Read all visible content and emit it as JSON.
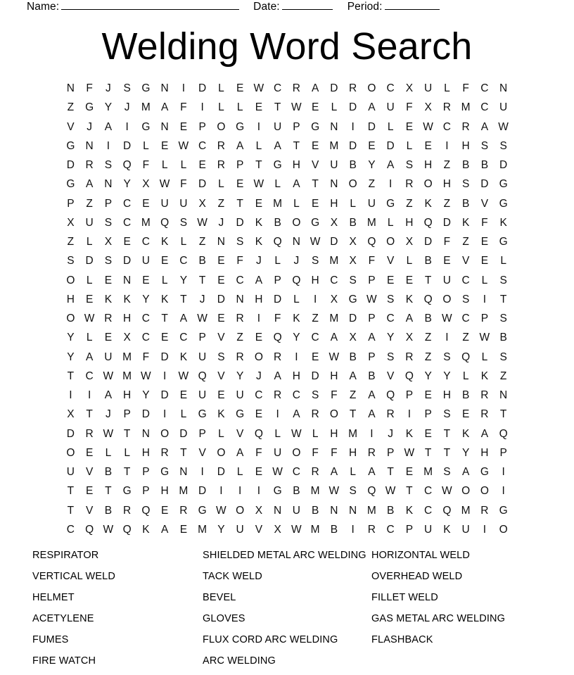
{
  "header": {
    "name_label": "Name:",
    "date_label": "Date:",
    "period_label": "Period:"
  },
  "title": "Welding Word Search",
  "grid": {
    "rows": 24,
    "cols": 23,
    "letters": [
      [
        "N",
        "F",
        "J",
        "S",
        "G",
        "N",
        "I",
        "D",
        "L",
        "E",
        "W",
        "C",
        "R",
        "A",
        "D",
        "R",
        "O",
        "C",
        "X",
        "U",
        "L",
        "F",
        "C",
        "N"
      ],
      [
        "Z",
        "G",
        "Y",
        "J",
        "M",
        "A",
        "F",
        "I",
        "L",
        "L",
        "E",
        "T",
        "W",
        "E",
        "L",
        "D",
        "A",
        "U",
        "F",
        "X",
        "R",
        "M",
        "C",
        "U"
      ],
      [
        "V",
        "J",
        "A",
        "I",
        "G",
        "N",
        "E",
        "P",
        "O",
        "G",
        "I",
        "U",
        "P",
        "G",
        "N",
        "I",
        "D",
        "L",
        "E",
        "W",
        "C",
        "R",
        "A",
        "W"
      ],
      [
        "G",
        "N",
        "I",
        "D",
        "L",
        "E",
        "W",
        "C",
        "R",
        "A",
        "L",
        "A",
        "T",
        "E",
        "M",
        "D",
        "E",
        "D",
        "L",
        "E",
        "I",
        "H",
        "S",
        "S"
      ],
      [
        "D",
        "R",
        "S",
        "Q",
        "F",
        "L",
        "L",
        "E",
        "R",
        "P",
        "T",
        "G",
        "H",
        "V",
        "U",
        "B",
        "Y",
        "A",
        "S",
        "H",
        "Z",
        "B",
        "B",
        "D"
      ],
      [
        "G",
        "A",
        "N",
        "Y",
        "X",
        "W",
        "F",
        "D",
        "L",
        "E",
        "W",
        "L",
        "A",
        "T",
        "N",
        "O",
        "Z",
        "I",
        "R",
        "O",
        "H",
        "S",
        "D",
        "G"
      ],
      [
        "P",
        "Z",
        "P",
        "C",
        "E",
        "U",
        "U",
        "X",
        "Z",
        "T",
        "E",
        "M",
        "L",
        "E",
        "H",
        "L",
        "U",
        "G",
        "Z",
        "K",
        "Z",
        "B",
        "V",
        "G"
      ],
      [
        "X",
        "U",
        "S",
        "C",
        "M",
        "Q",
        "S",
        "W",
        "J",
        "D",
        "K",
        "B",
        "O",
        "G",
        "X",
        "B",
        "M",
        "L",
        "H",
        "Q",
        "D",
        "K",
        "F",
        "K"
      ],
      [
        "Z",
        "L",
        "X",
        "E",
        "C",
        "K",
        "L",
        "Z",
        "N",
        "S",
        "K",
        "Q",
        "N",
        "W",
        "D",
        "X",
        "Q",
        "O",
        "X",
        "D",
        "F",
        "Z",
        "E",
        "G"
      ],
      [
        "S",
        "D",
        "S",
        "D",
        "U",
        "E",
        "C",
        "B",
        "E",
        "F",
        "J",
        "L",
        "J",
        "S",
        "M",
        "X",
        "F",
        "V",
        "L",
        "B",
        "E",
        "V",
        "E",
        "L"
      ],
      [
        "O",
        "L",
        "E",
        "N",
        "E",
        "L",
        "Y",
        "T",
        "E",
        "C",
        "A",
        "P",
        "Q",
        "H",
        "C",
        "S",
        "P",
        "E",
        "E",
        "T",
        "U",
        "C",
        "L",
        "S"
      ],
      [
        "H",
        "E",
        "K",
        "K",
        "Y",
        "K",
        "T",
        "J",
        "D",
        "N",
        "H",
        "D",
        "L",
        "I",
        "X",
        "G",
        "W",
        "S",
        "K",
        "Q",
        "O",
        "S",
        "I",
        "T"
      ],
      [
        "O",
        "W",
        "R",
        "H",
        "C",
        "T",
        "A",
        "W",
        "E",
        "R",
        "I",
        "F",
        "K",
        "Z",
        "M",
        "D",
        "P",
        "C",
        "A",
        "B",
        "W",
        "C",
        "P",
        "S"
      ],
      [
        "Y",
        "L",
        "E",
        "X",
        "C",
        "E",
        "C",
        "P",
        "V",
        "Z",
        "E",
        "Q",
        "Y",
        "C",
        "A",
        "X",
        "A",
        "Y",
        "X",
        "Z",
        "I",
        "Z",
        "W",
        "B"
      ],
      [
        "Y",
        "A",
        "U",
        "M",
        "F",
        "D",
        "K",
        "U",
        "S",
        "R",
        "O",
        "R",
        "I",
        "E",
        "W",
        "B",
        "P",
        "S",
        "R",
        "Z",
        "S",
        "Q",
        "L",
        "S"
      ],
      [
        "T",
        "C",
        "W",
        "M",
        "W",
        "I",
        "W",
        "Q",
        "V",
        "Y",
        "J",
        "A",
        "H",
        "D",
        "H",
        "A",
        "B",
        "V",
        "Q",
        "Y",
        "Y",
        "L",
        "K",
        "Z"
      ],
      [
        "I",
        "I",
        "A",
        "H",
        "Y",
        "D",
        "E",
        "U",
        "E",
        "U",
        "C",
        "R",
        "C",
        "S",
        "F",
        "Z",
        "A",
        "Q",
        "P",
        "E",
        "H",
        "B",
        "R",
        "N"
      ],
      [
        "X",
        "T",
        "J",
        "P",
        "D",
        "I",
        "L",
        "G",
        "K",
        "G",
        "E",
        "I",
        "A",
        "R",
        "O",
        "T",
        "A",
        "R",
        "I",
        "P",
        "S",
        "E",
        "R",
        "T"
      ],
      [
        "D",
        "R",
        "W",
        "T",
        "N",
        "O",
        "D",
        "P",
        "L",
        "V",
        "Q",
        "L",
        "W",
        "L",
        "H",
        "M",
        "I",
        "J",
        "K",
        "E",
        "T",
        "K",
        "A",
        "Q"
      ],
      [
        "O",
        "E",
        "L",
        "L",
        "H",
        "R",
        "T",
        "V",
        "O",
        "A",
        "F",
        "U",
        "O",
        "F",
        "F",
        "H",
        "R",
        "P",
        "W",
        "T",
        "T",
        "Y",
        "H",
        "P"
      ],
      [
        "U",
        "V",
        "B",
        "T",
        "P",
        "G",
        "N",
        "I",
        "D",
        "L",
        "E",
        "W",
        "C",
        "R",
        "A",
        "L",
        "A",
        "T",
        "E",
        "M",
        "S",
        "A",
        "G",
        "I"
      ],
      [
        "T",
        "E",
        "T",
        "G",
        "P",
        "H",
        "M",
        "D",
        "I",
        "I",
        "I",
        "G",
        "B",
        "M",
        "W",
        "S",
        "Q",
        "W",
        "T",
        "C",
        "W",
        "O",
        "O",
        "I"
      ],
      [
        "T",
        "V",
        "B",
        "R",
        "Q",
        "E",
        "R",
        "G",
        "W",
        "O",
        "X",
        "N",
        "U",
        "B",
        "N",
        "N",
        "M",
        "B",
        "K",
        "C",
        "Q",
        "M",
        "R",
        "G"
      ],
      [
        "C",
        "Q",
        "W",
        "Q",
        "K",
        "A",
        "E",
        "M",
        "Y",
        "U",
        "V",
        "X",
        "W",
        "M",
        "B",
        "I",
        "R",
        "C",
        "P",
        "U",
        "K",
        "U",
        "I",
        "O"
      ]
    ]
  },
  "word_list": {
    "rows": [
      [
        "RESPIRATOR",
        "SHIELDED METAL ARC WELDING",
        "HORIZONTAL WELD"
      ],
      [
        "VERTICAL WELD",
        "TACK WELD",
        "OVERHEAD WELD"
      ],
      [
        "HELMET",
        "BEVEL",
        "FILLET WELD"
      ],
      [
        "ACETYLENE",
        "GLOVES",
        "GAS METAL ARC WELDING"
      ],
      [
        "FUMES",
        "FLUX CORD ARC WELDING",
        "FLASHBACK"
      ],
      [
        "FIRE WATCH",
        "ARC WELDING",
        ""
      ]
    ]
  }
}
